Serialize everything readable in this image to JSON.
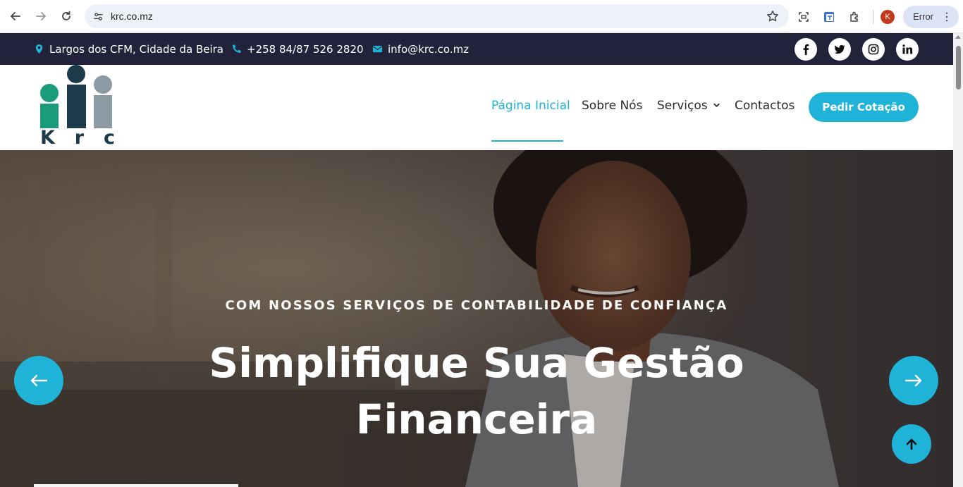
{
  "browser": {
    "url": "krc.co.mz",
    "profile_initial": "K",
    "status_label": "Error"
  },
  "topbar": {
    "address": "Largos dos CFM, Cidade da Beira",
    "phone": "+258 84/87 526 2820",
    "email": "info@krc.co.mz",
    "socials": [
      "facebook-icon",
      "twitter-icon",
      "instagram-icon",
      "linkedin-icon"
    ]
  },
  "logo": {
    "letters": [
      "K",
      "r",
      "c"
    ],
    "colors": [
      "#1a9b7b",
      "#1c3a4a",
      "#8c9aa3"
    ]
  },
  "nav": {
    "items": [
      {
        "label": "Página Inicial",
        "active": true
      },
      {
        "label": "Sobre Nós",
        "active": false
      },
      {
        "label": "Serviços",
        "active": false,
        "has_dropdown": true
      },
      {
        "label": "Contactos",
        "active": false
      }
    ],
    "cta_label": "Pedir Cotação"
  },
  "hero": {
    "kicker": "COM NOSSOS SERVIÇOS DE CONTABILIDADE DE CONFIANÇA",
    "title": "Simplifique Sua Gestão Financeira",
    "slide_progress": 0.23
  },
  "colors": {
    "accent": "#1fb3d8",
    "topbar_bg": "#22223a",
    "text_dark": "#2a2a2a"
  }
}
